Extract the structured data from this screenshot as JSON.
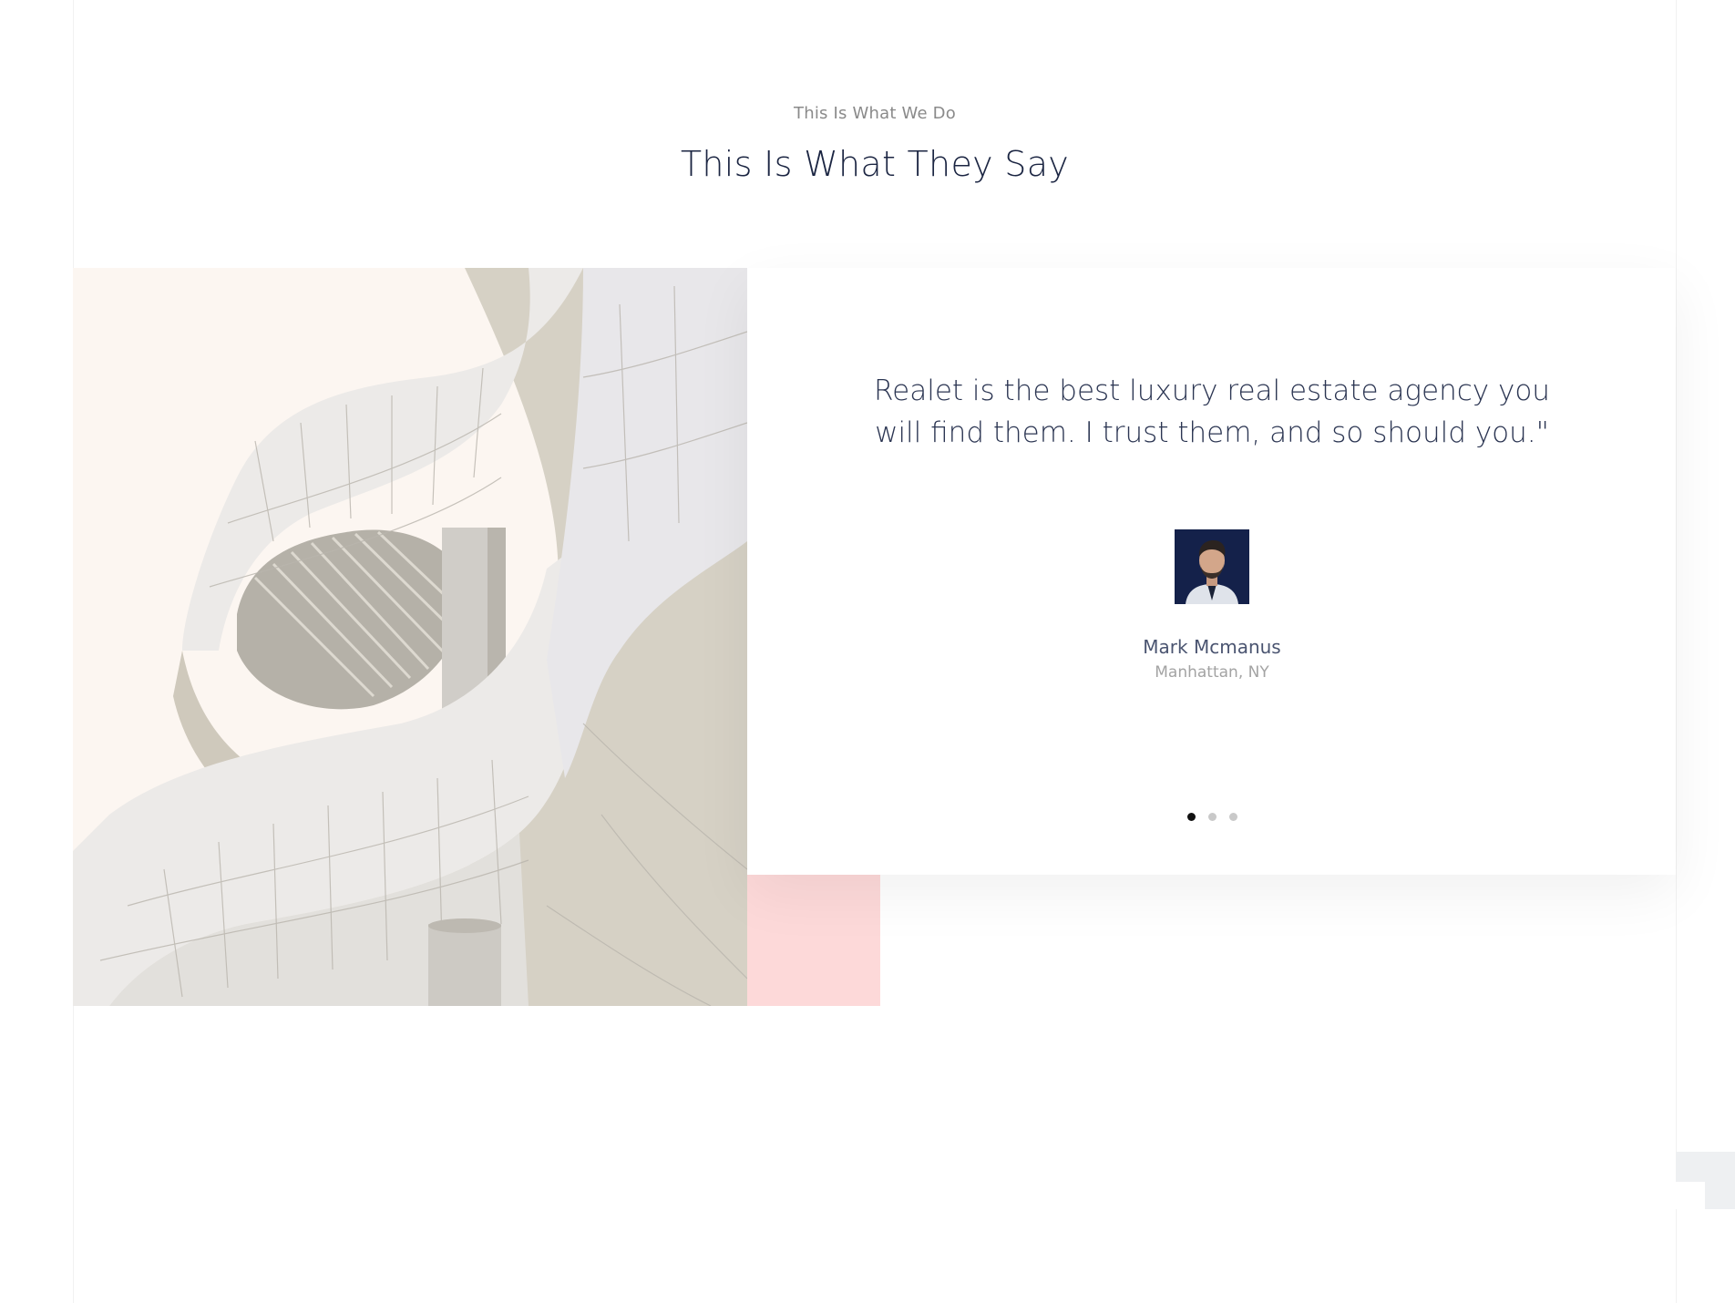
{
  "section": {
    "eyebrow": "This Is What We Do",
    "title": "This Is What They Say"
  },
  "testimonial": {
    "quote": "Realet is the best luxury real estate agency you will find them. I trust them, and so should you.\"",
    "author_name": "Mark Mcmanus",
    "author_location": "Manhattan, NY",
    "avatar_icon": "person-avatar-icon",
    "image_icon": "architecture-photo",
    "slides": 3,
    "active_slide": 1
  },
  "colors": {
    "title": "#1b2542",
    "eyebrow": "#8a8a8a",
    "accent_pink": "#fdd9d9",
    "dot_active": "#111111",
    "dot_inactive": "#c9c9c9"
  }
}
